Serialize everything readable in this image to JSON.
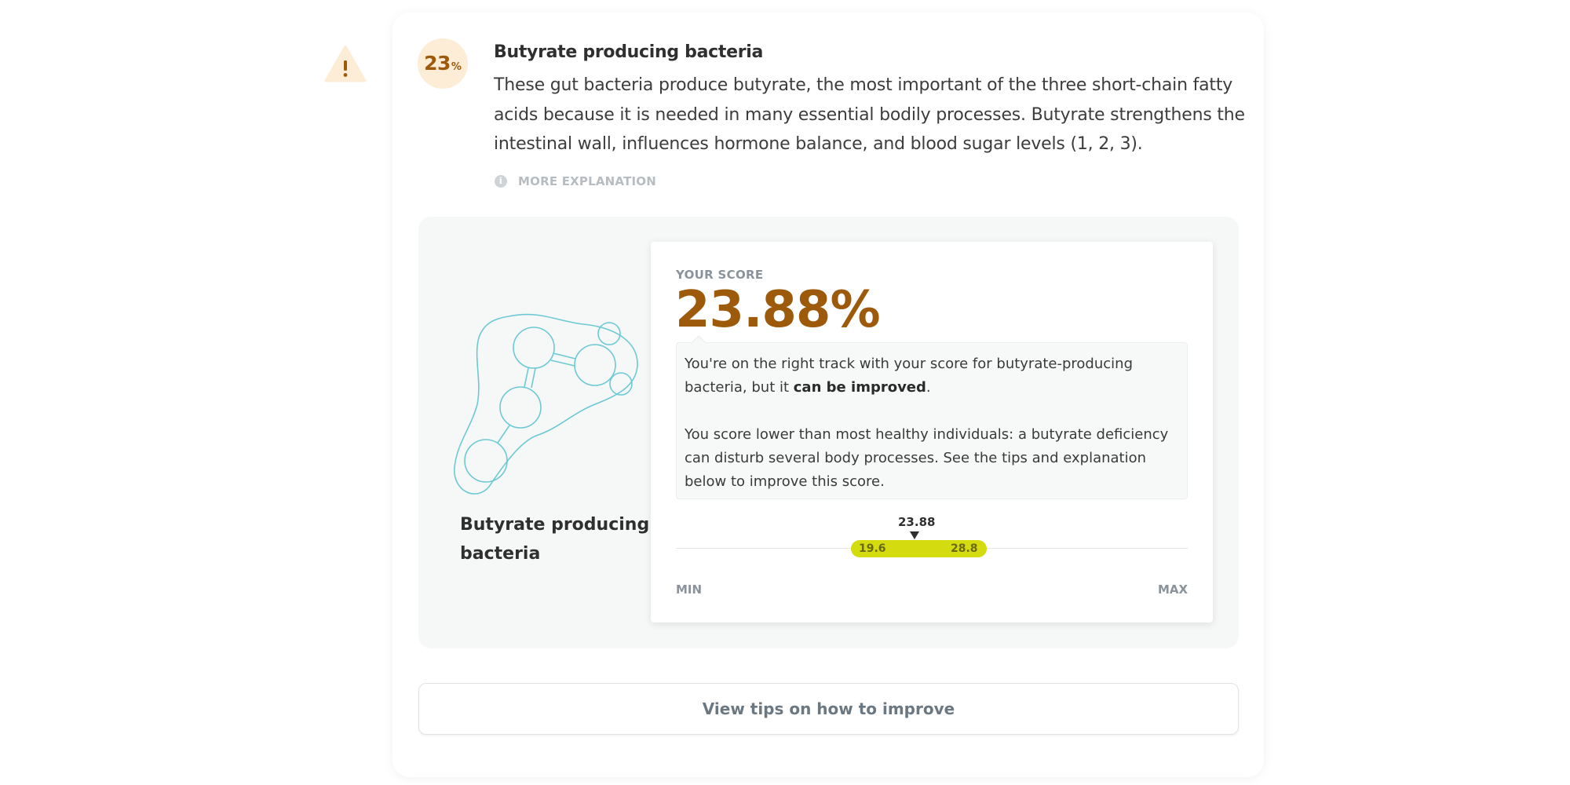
{
  "warning": {
    "icon": "warning-icon",
    "symbol": "!",
    "color": "#fdecd6"
  },
  "item": {
    "badge_value": "23",
    "badge_unit": "%",
    "title": "Butyrate producing bacteria",
    "description": "These gut bacteria produce butyrate, the most important of the three short-chain fatty acids because it is needed in many essential bodily processes. Butyrate strengthens the intestinal wall, influences hormone balance, and blood sugar levels (1, 2, 3).",
    "more_link": "MORE EXPLANATION",
    "more_icon": "info-icon"
  },
  "panel": {
    "illustration_icon": "bacteria-molecule-icon",
    "label": "Butyrate producing bacteria"
  },
  "score": {
    "label": "YOUR SCORE",
    "value": "23.88%",
    "message_1_a": "You're on the right track with your score for butyrate-producing bacteria, but it ",
    "message_1_strong": "can be improved",
    "message_1_b": ".",
    "message_2": "You score lower than most healthy individuals: a butyrate deficiency can disturb several body processes. See the tips and explanation below to improve this score.",
    "marker_label": "23.88",
    "range_low_label": "19.6",
    "range_high_label": "28.8",
    "min_label": "MIN",
    "max_label": "MAX",
    "range_color": "#d4db0e",
    "value_color": "#9c5a0a"
  },
  "tips_button": {
    "label": "View tips on how to improve"
  }
}
